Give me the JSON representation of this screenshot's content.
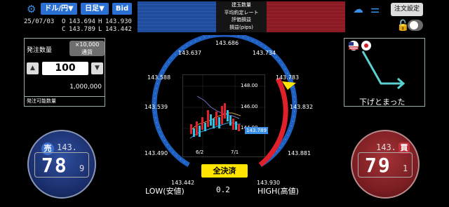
{
  "header": {
    "pair": "ドル/円▼",
    "timeframe": "日足▼",
    "side_toggle": "Bid",
    "date": "25/07/03",
    "o_label": "O",
    "o_value": "143.694",
    "h_label": "H",
    "h_value": "143.930",
    "c_label": "C",
    "c_value": "143.789",
    "l_label": "L",
    "l_value": "143.442",
    "center_lines": [
      "建玉数量",
      "平均約定レート",
      "評価損益",
      "損益(pips)"
    ],
    "order_settings": "注文設定"
  },
  "order": {
    "qty_label": "発注数量",
    "multiplier_line1": "×10,000",
    "multiplier_line2": "通貨",
    "qty_value": "100",
    "amount": "1,000,000",
    "available_label": "発注可能数量"
  },
  "direction": {
    "text": "下げとまった"
  },
  "gauge": {
    "ticks": [
      "143.442",
      "143.490",
      "143.539",
      "143.588",
      "143.637",
      "143.686",
      "143.734",
      "143.783",
      "143.832",
      "143.881",
      "143.930"
    ],
    "current_price": "143.789",
    "chart_ylabels": [
      "148.00",
      "146.00",
      "144.00"
    ],
    "chart_xlabels": [
      "6/2",
      "7/1"
    ]
  },
  "controls": {
    "close_all": "全決済",
    "low_label": "LOW(安値)",
    "high_label": "HIGH(高値)",
    "spread": "0.2"
  },
  "sell": {
    "label": "売",
    "prefix": "143.",
    "big": "78",
    "small": "9"
  },
  "buy": {
    "label": "買",
    "prefix": "143.",
    "big": "79",
    "small": "1"
  },
  "colors": {
    "blue": "#3a8fe8",
    "red": "#e0202a",
    "yellow": "#ffe600"
  }
}
